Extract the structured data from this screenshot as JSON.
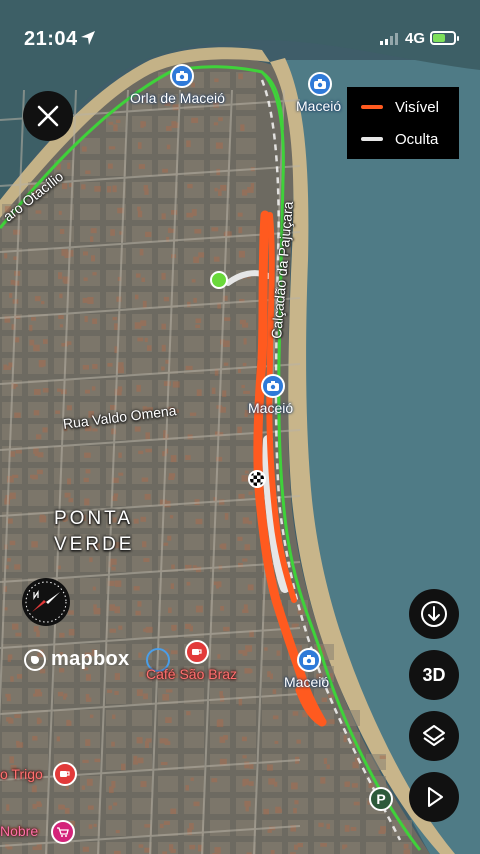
{
  "status_bar": {
    "time": "21:04",
    "network": "4G"
  },
  "legend": {
    "items": [
      {
        "label": "Visível",
        "color": "#ff5a1f"
      },
      {
        "label": "Oculta",
        "color": "#e6e6e6"
      }
    ]
  },
  "map": {
    "district": {
      "line1": "PONTA",
      "line2": "VERDE"
    },
    "streets": {
      "otacilio": "aro Otacílio",
      "valdo": "Rua Valdo Omena",
      "pajucara": "Calçadão da Pajuçara"
    },
    "pois": {
      "orla": "Orla de Maceió",
      "maceio_top": "Maceió",
      "maceio_mid": "Maceió",
      "maceio_low": "Maceió",
      "cafe_braz": "Café São Braz",
      "trigo": "o Trigo",
      "nobre": "Nobre"
    },
    "route_color": "#ff5a1f",
    "track_color": "#3fd23a",
    "parking_label": "P"
  },
  "controls": {
    "three_d": "3D"
  },
  "attribution": "mapbox"
}
